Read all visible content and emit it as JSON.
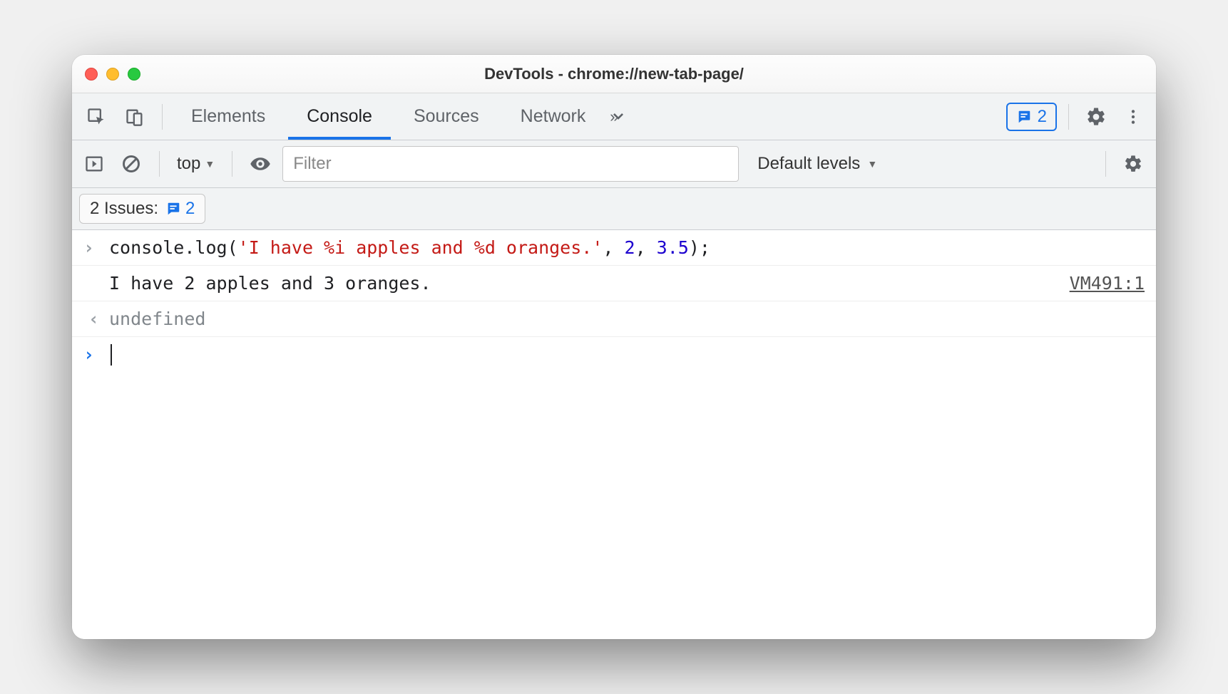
{
  "window": {
    "title": "DevTools - chrome://new-tab-page/"
  },
  "tabs": {
    "elements": "Elements",
    "console": "Console",
    "sources": "Sources",
    "network": "Network"
  },
  "header": {
    "issues_count": "2"
  },
  "toolbar": {
    "context": "top",
    "filter_placeholder": "Filter",
    "levels": "Default levels"
  },
  "issues": {
    "label": "2 Issues:",
    "count": "2"
  },
  "console": {
    "input": {
      "method": "console.log",
      "open": "(",
      "string": "'I have %i apples and %d oranges.'",
      "sep1": ", ",
      "arg1": "2",
      "sep2": ", ",
      "arg2": "3.5",
      "close": ");"
    },
    "output": "I have 2 apples and 3 oranges.",
    "source": "VM491:1",
    "return": "undefined"
  }
}
